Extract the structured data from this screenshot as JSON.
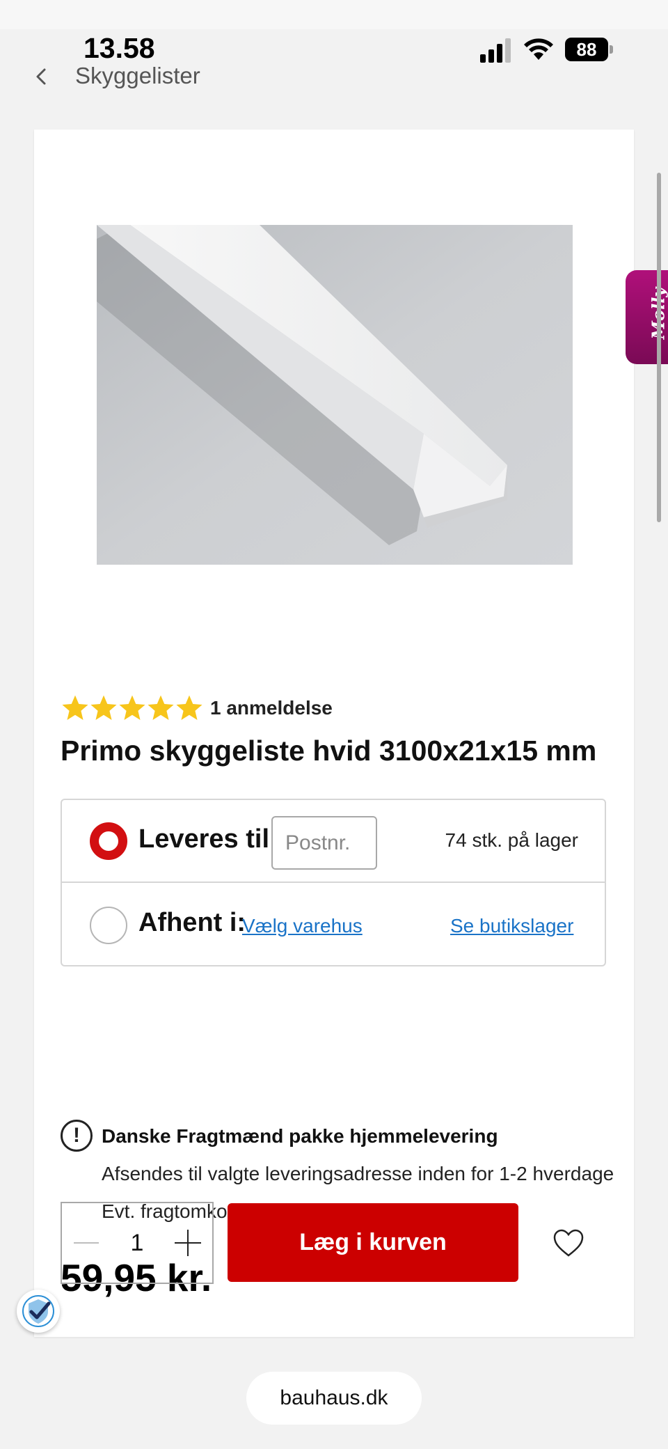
{
  "status_bar": {
    "time": "13.58",
    "battery": "88"
  },
  "nav": {
    "title": "Skyggelister"
  },
  "product": {
    "rating_stars": 5,
    "review_count": "1 anmeldelse",
    "title": "Primo skyggeliste hvid 3100x21x15 mm",
    "price": "59,95 kr."
  },
  "delivery": {
    "deliver_label": "Leveres til:",
    "postnr_placeholder": "Postnr.",
    "stock": "74 stk. på lager",
    "pickup_label": "Afhent i:",
    "store_link": "Vælg varehus",
    "stock_link": "Se butikslager"
  },
  "notice": {
    "icon": "!",
    "title": "Danske Fragtmænd pakke hjemmelevering",
    "line1": "Afsendes til valgte leveringsadresse inden for 1-2 hverdage",
    "line2": "Evt. fragtomkostninger tillægges"
  },
  "cart": {
    "quantity": "1",
    "button_label": "Læg i kurven"
  },
  "molly": {
    "label": "Molly"
  },
  "browser": {
    "url": "bauhaus.dk"
  },
  "colors": {
    "accent_red": "#cc0000",
    "link_blue": "#1a73c7",
    "star_yellow": "#f7c51b",
    "molly_purple": "#9a0d6b"
  }
}
